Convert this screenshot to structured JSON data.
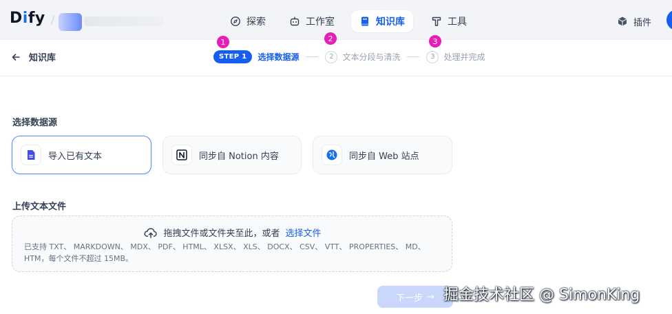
{
  "header": {
    "logo": {
      "pre": "D",
      "accent": "i",
      "post": "fy"
    },
    "separator": "/",
    "nav": [
      {
        "label": "探索",
        "icon": "compass-icon"
      },
      {
        "label": "工作室",
        "icon": "robot-icon"
      },
      {
        "label": "知识库",
        "icon": "book-icon",
        "active": true
      },
      {
        "label": "工具",
        "icon": "hammer-icon"
      }
    ],
    "plugins_label": "插件"
  },
  "stepbar": {
    "back_label": "知识库",
    "steps": [
      {
        "badge": "STEP 1",
        "label": "选择数据源",
        "active": true
      },
      {
        "badge": "2",
        "label": "文本分段与清洗"
      },
      {
        "badge": "3",
        "label": "处理并完成"
      }
    ]
  },
  "markers": [
    "1",
    "2",
    "3"
  ],
  "data_source": {
    "title": "选择数据源",
    "options": [
      {
        "label": "导入已有文本",
        "icon": "file-text-icon",
        "selected": true
      },
      {
        "label": "同步自 Notion 内容",
        "icon": "notion-icon"
      },
      {
        "label": "同步自 Web 站点",
        "icon": "web-globe-icon"
      }
    ]
  },
  "upload": {
    "title": "上传文本文件",
    "drag_text": "拖拽文件或文件夹至此，或者",
    "select_link": "选择文件",
    "tip": "已支持 TXT、 MARKDOWN、 MDX、 PDF、 HTML、 XLSX、 XLS、 DOCX、 CSV、 VTT、 PROPERTIES、 MD、 HTM，每个文件不超过 15MB。"
  },
  "next_button": {
    "label": "下一步",
    "arrow": "→"
  },
  "watermark": "掘金技术社区 @ SimonKing",
  "colors": {
    "accent": "#155eef",
    "marker": "#e81eb6",
    "topbar_bg": "#f2f4f7"
  }
}
